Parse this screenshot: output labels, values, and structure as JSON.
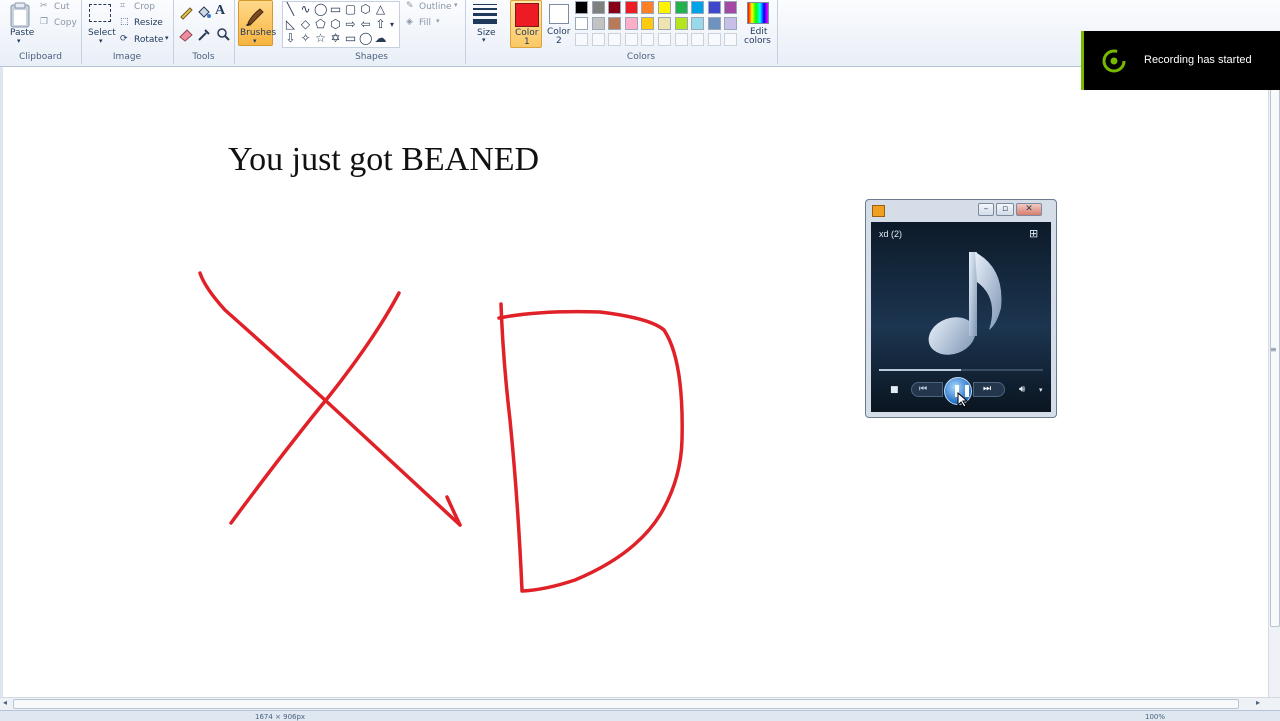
{
  "ribbon": {
    "clipboard": {
      "paste": "Paste",
      "cut": "Cut",
      "copy": "Copy",
      "label": "Clipboard"
    },
    "image": {
      "select": "Select",
      "crop": "Crop",
      "resize": "Resize",
      "rotate": "Rotate",
      "label": "Image"
    },
    "tools": {
      "label": "Tools"
    },
    "brushes": {
      "label": "Brushes"
    },
    "shapes": {
      "outline": "Outline",
      "fill": "Fill",
      "label": "Shapes"
    },
    "size": {
      "label": "Size"
    },
    "colors": {
      "color1_line1": "Color",
      "color1_line2": "1",
      "color2_line1": "Color",
      "color2_line2": "2",
      "edit_line1": "Edit",
      "edit_line2": "colors",
      "label": "Colors",
      "color1_value": "#ed1c24",
      "color2_value": "#ffffff",
      "palette_row1": [
        "#000000",
        "#7f7f7f",
        "#880015",
        "#ed1c24",
        "#ff7f27",
        "#fff200",
        "#22b14c",
        "#00a2e8",
        "#3f48cc",
        "#a349a4"
      ],
      "palette_row2": [
        "#ffffff",
        "#c3c3c3",
        "#b97a57",
        "#ffaec9",
        "#ffc90e",
        "#efe4b0",
        "#b5e61d",
        "#99d9ea",
        "#7092be",
        "#c8bfe7"
      ]
    }
  },
  "canvas": {
    "title_text": "You just got BEANED",
    "ink_color": "#e02128"
  },
  "notification": {
    "text": "Recording has started",
    "accent": "#76b900"
  },
  "media_player": {
    "track": "xd (2)",
    "progress": 0.5
  },
  "statusbar": {
    "dimensions": "1674 × 906px",
    "zoom": "100%"
  }
}
